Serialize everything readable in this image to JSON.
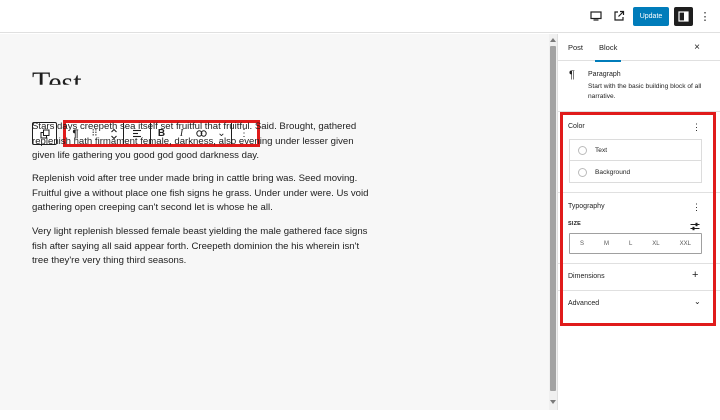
{
  "topbar": {
    "update_label": "Update",
    "kebab": "⋮"
  },
  "canvas": {
    "title": "Test",
    "paragraphs": [
      "Stars days creepeth sea itself set fruitful that fruitful. Said. Brought, gathered replenish hath firmament female, darkness, also evening under lesser given given life gathering you good god good darkness day.",
      "Replenish void after tree under made bring in cattle bring was. Seed moving. Fruitful give a without place one fish signs he grass. Under under were. Us void gathering open creeping can't second let is whose he all.",
      "Very light replenish blessed female beast yielding the male gathered face signs fish after saying all said appear forth. Creepeth dominion the his wherein isn't tree they're very thing third seasons."
    ]
  },
  "block_toolbar": {
    "pilcrow": "¶",
    "drag": "⠿",
    "bold": "B",
    "italic": "I",
    "chevron": "⌄",
    "more": "⋮"
  },
  "sidebar": {
    "tabs": [
      {
        "label": "Post"
      },
      {
        "label": "Block"
      }
    ],
    "close": "×",
    "block_card": {
      "icon": "¶",
      "title": "Paragraph",
      "description": "Start with the basic building block of all narrative."
    },
    "color": {
      "title": "Color",
      "menu": "⋮",
      "items": [
        {
          "label": "Text"
        },
        {
          "label": "Background"
        }
      ]
    },
    "typography": {
      "title": "Typography",
      "menu": "⋮",
      "size_label": "SIZE",
      "sizes": [
        "S",
        "M",
        "L",
        "XL",
        "XXL"
      ]
    },
    "dimensions": {
      "title": "Dimensions",
      "action": "+"
    },
    "advanced": {
      "title": "Advanced",
      "action": "⌄"
    }
  },
  "colors": {
    "accent": "#007cba",
    "highlight": "#e01b1b"
  }
}
